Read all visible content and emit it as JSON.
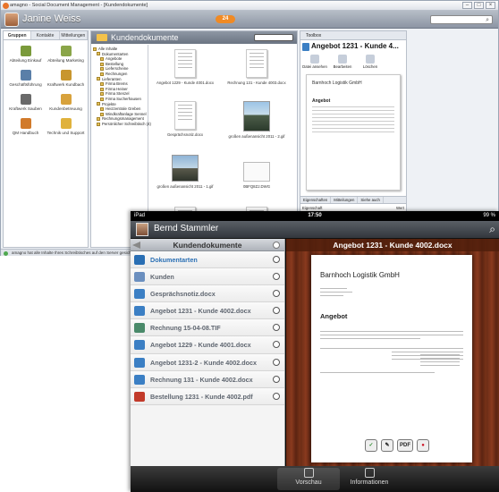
{
  "window": {
    "title": "amagno - Social Document Management - [Kundendokumente]"
  },
  "user": {
    "name": "Janine Weiss",
    "notification_count": "24"
  },
  "left_panel": {
    "tabs": [
      "Gruppen",
      "Kontakte",
      "Mitteilungen"
    ],
    "groups": [
      {
        "label": "Abteilung Einkauf",
        "icon": "group-icon",
        "color": "#7a9a3a"
      },
      {
        "label": "Abteilung Marketing",
        "icon": "group-icon",
        "color": "#8aa548"
      },
      {
        "label": "Geschäftsführung",
        "icon": "group-icon",
        "color": "#5a7fa8"
      },
      {
        "label": "Kraftwerk Kundbach",
        "icon": "group-icon",
        "color": "#c8962e"
      },
      {
        "label": "Kraftwerk Sauben",
        "icon": "group-icon",
        "color": "#6a6a6a"
      },
      {
        "label": "Kundenbetreuung",
        "icon": "group-icon",
        "color": "#d8a23c"
      },
      {
        "label": "QM Handbuch",
        "icon": "group-icon",
        "color": "#d17a2a"
      },
      {
        "label": "Technik und Support",
        "icon": "group-icon",
        "color": "#e0b23c"
      }
    ]
  },
  "middle_panel": {
    "title": "Kundendokumente",
    "filter_label": "Alle Inhalte",
    "tree": [
      "Alle Inhalte",
      "Dokumentarten",
      "Angebote",
      "Bestellung",
      "Lieferscheine",
      "Rechnungen",
      "Lieferanten",
      "Firma Brems",
      "Firma Heiner",
      "Firma Stenzel",
      "Firma Sucherhausen",
      "Projekte",
      "Heizzentrale Greben",
      "Windkraftanlage Sennel",
      "Rechnungsmanagement",
      "Persönlicher Schreibtisch (4)"
    ],
    "files": [
      "Angebot 1229 - Kunde 4001.docx",
      "Rechnung 131 - Kunde 4003.docx",
      "Gesprächsnotiz.docx",
      "großen außenansicht 2011 - 2.gif",
      "großen außenansicht 2011 - 1.gif",
      "0BFQ8ZJ.DWG"
    ]
  },
  "right_panel": {
    "tab": "Toolbox",
    "doc_title": "Angebot 1231 - Kunde 4...",
    "tools": [
      "Datei ansehen",
      "Bearbeiten",
      "Löschen"
    ],
    "preview_company": "Barnhoch Logistik GmbH",
    "preview_heading": "Angebot",
    "bottom_tabs": [
      "Eigenschaften",
      "Mitteilungen",
      "Siehe auch"
    ],
    "properties": [
      {
        "key": "Eigenschaft",
        "value": "Wert"
      },
      {
        "key": "Erstellt",
        "value": "Start"
      }
    ]
  },
  "status": {
    "text": "amagno hat alle Inhalte Ihres Schreibtisches auf den Server gesichert"
  },
  "tablet": {
    "status_left": "iPad",
    "time": "17:50",
    "battery": "99 %",
    "user_name": "Bernd Stammler",
    "list_title": "Kundendokumente",
    "items": [
      {
        "label": "Dokumentarten",
        "color": "#2a6fb4"
      },
      {
        "label": "Kunden",
        "color": "#6b8fbf"
      },
      {
        "label": "Gesprächsnotiz.docx",
        "color": "#3b7fc4"
      },
      {
        "label": "Angebot 1231 - Kunde 4002.docx",
        "color": "#3b7fc4"
      },
      {
        "label": "Rechnung 15-04-08.TIF",
        "color": "#4a8a6a"
      },
      {
        "label": "Angebot 1229 - Kunde 4001.docx",
        "color": "#3b7fc4"
      },
      {
        "label": "Angebot 1231-2 - Kunde 4002.docx",
        "color": "#3b7fc4"
      },
      {
        "label": "Rechnung 131 - Kunde 4002.docx",
        "color": "#3b7fc4"
      },
      {
        "label": "Bestellung 1231 - Kunde 4002.pdf",
        "color": "#c23a2a"
      }
    ],
    "doc_title": "Angebot 1231 - Kunde 4002.docx",
    "doc": {
      "company": "Barnhoch Logistik GmbH",
      "heading": "Angebot"
    },
    "doc_buttons": [
      "✓",
      "✎",
      "PDF",
      "●"
    ],
    "tabs": [
      "Vorschau",
      "Informationen"
    ]
  }
}
